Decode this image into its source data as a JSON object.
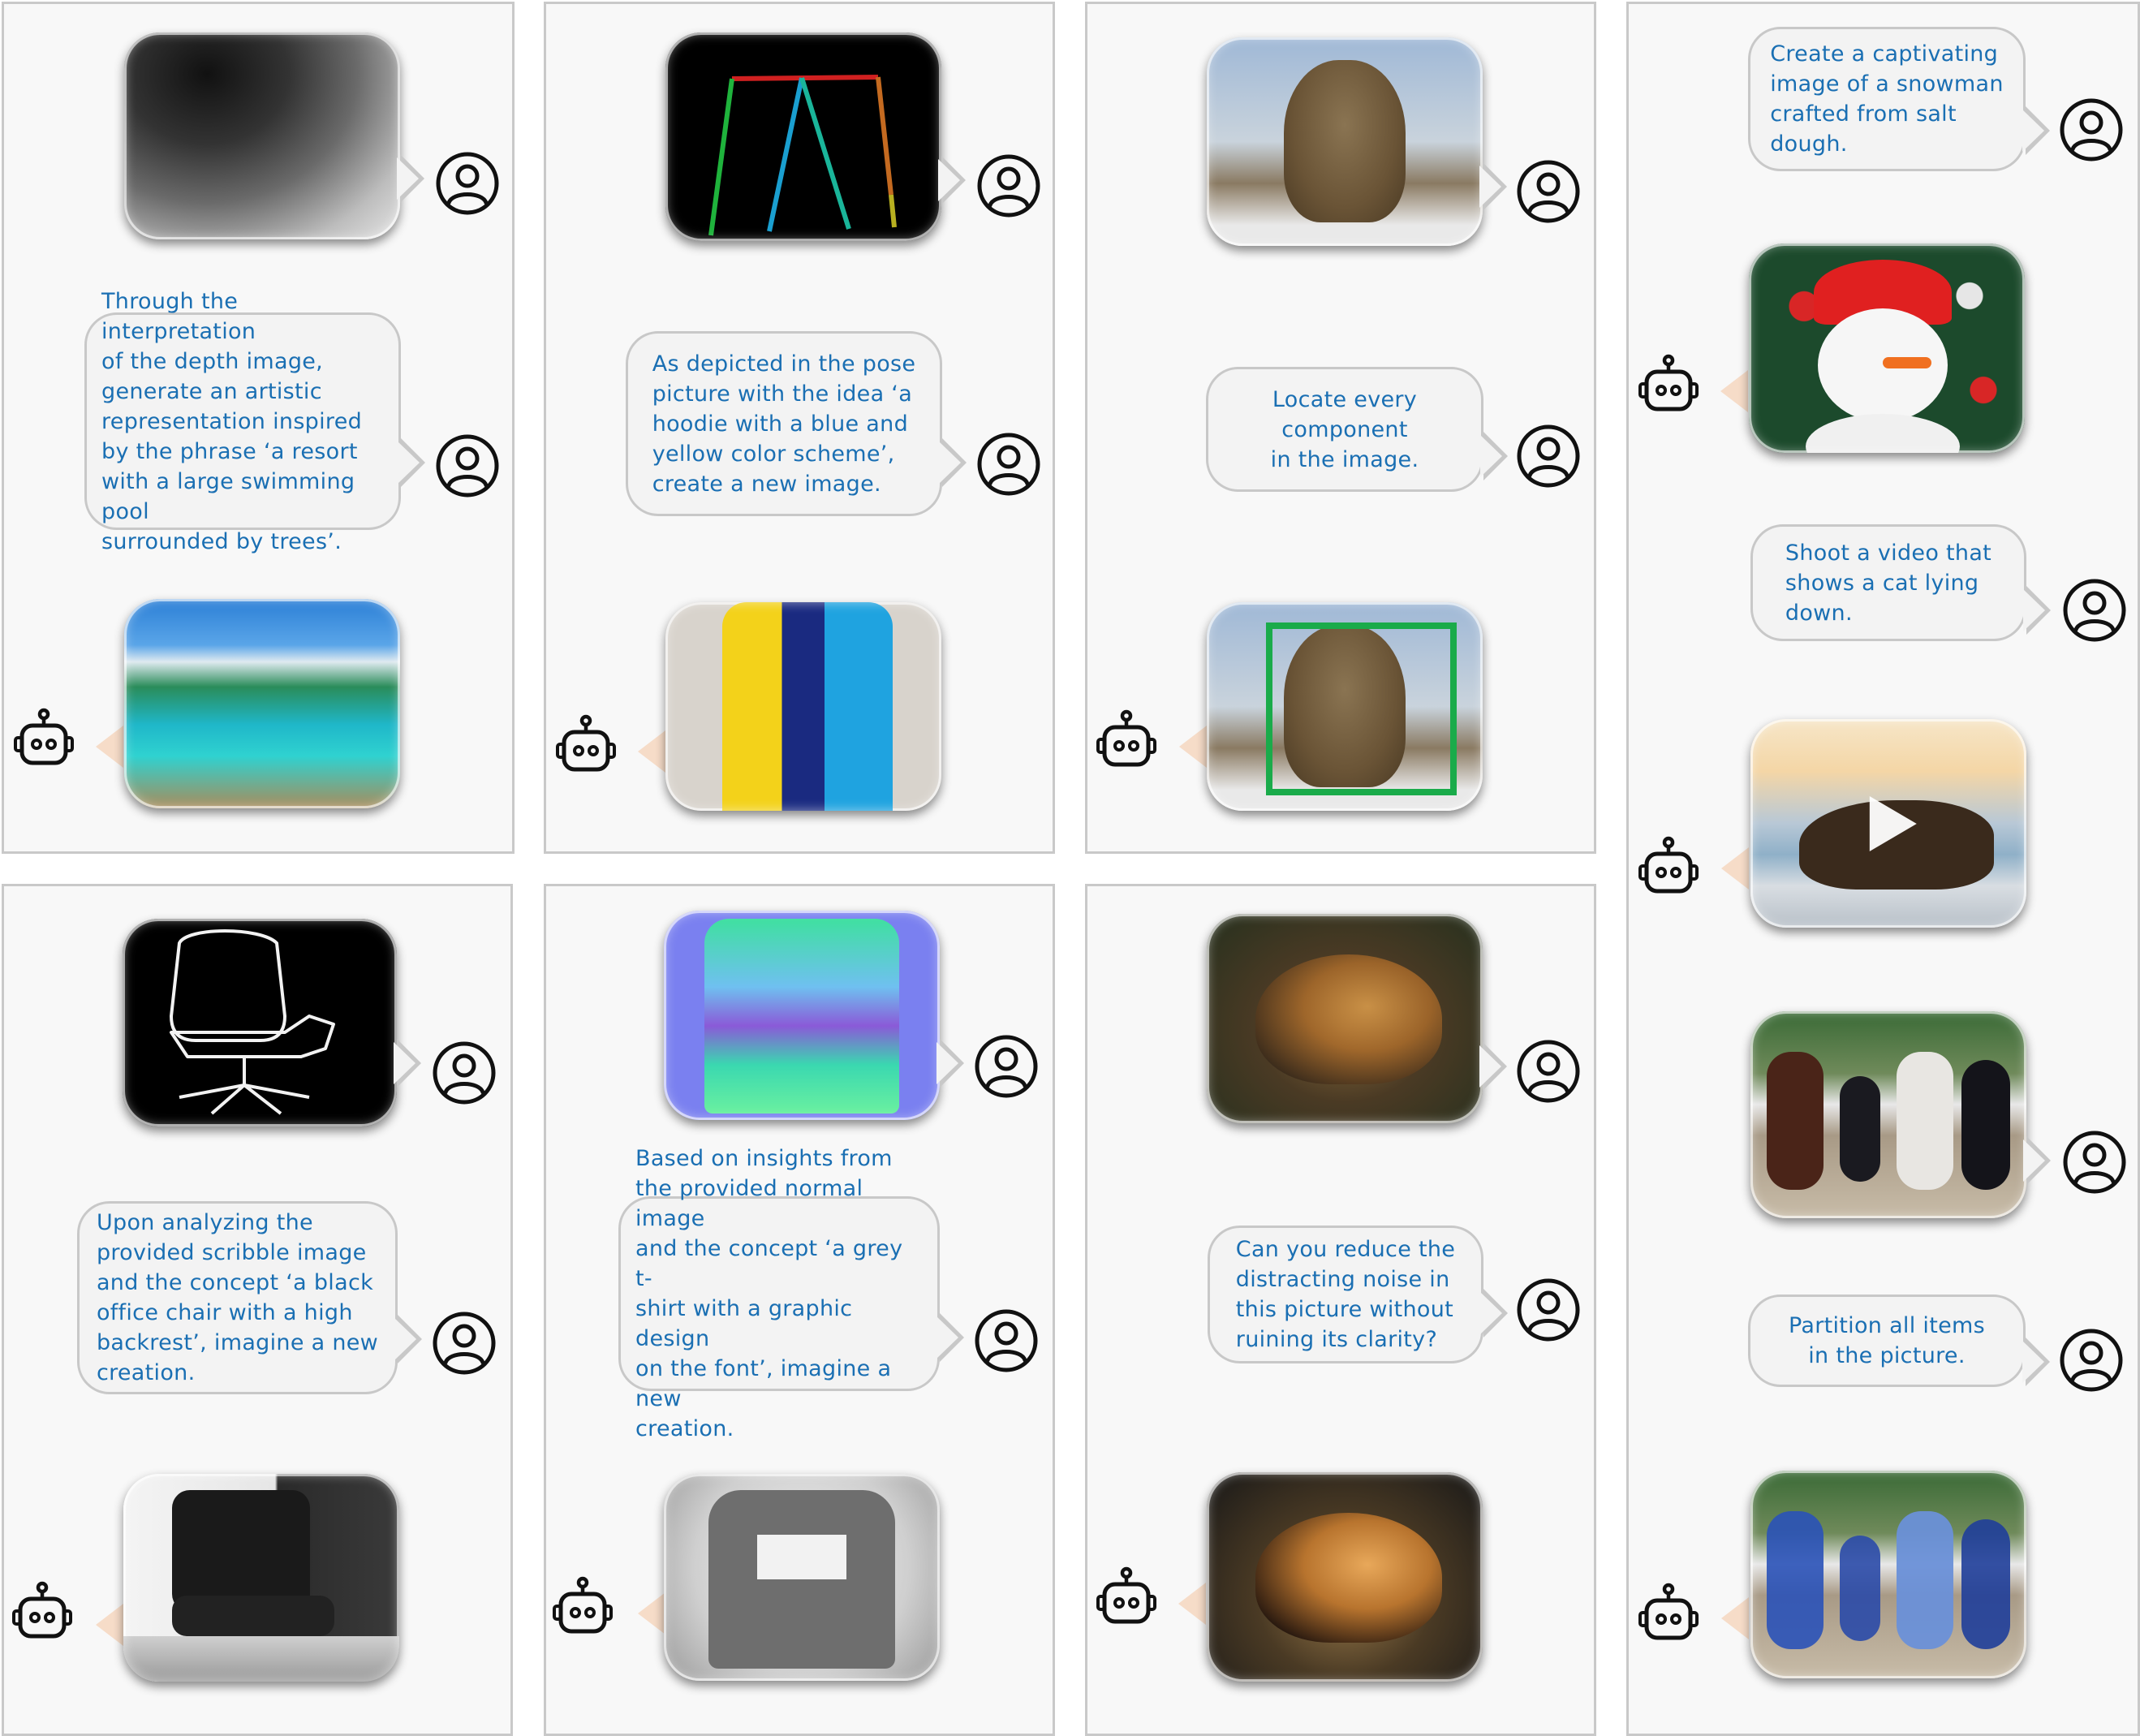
{
  "prompts": {
    "depth": "Through the interpretation\nof the depth image,\ngenerate an artistic\nrepresentation inspired\nby the phrase ‘a resort\nwith a large swimming pool\nsurrounded by trees’.",
    "pose": "As depicted in the pose\npicture with the idea ‘a\nhoodie with a blue and\nyellow color scheme’,\ncreate a new image.",
    "locate": "Locate every\ncomponent\nin the image.",
    "snowman": "Create a captivating\nimage of a snowman\ncrafted from salt\ndough.",
    "video": "Shoot a video that\nshows a cat lying\ndown.",
    "scribble": "Upon analyzing the\nprovided scribble image\nand the concept ‘a black\noffice chair with a high\nbackrest’, imagine a new\ncreation.",
    "normal": "Based on insights from\nthe provided normal image\nand the concept ‘a grey t-\nshirt with a graphic design\non the font’, imagine a new\ncreation.",
    "denoise": "Can you reduce the\ndistracting noise in\nthis picture without\nruining its clarity?",
    "partition": "Partition all items\nin the picture."
  },
  "icons": {
    "user": "user-icon",
    "robot": "robot-icon"
  },
  "colors": {
    "text": "#1a6fb3",
    "bubble_bg": "#f3f3f3",
    "bubble_border": "#c8c8c8",
    "panel_bg": "#f8f8f8",
    "bbox_green": "#1aab4a",
    "mask_blue": "#2a52b8"
  }
}
